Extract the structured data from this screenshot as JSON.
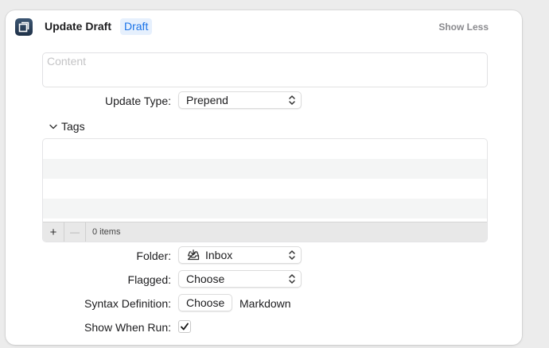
{
  "header": {
    "title": "Update Draft",
    "token": "Draft",
    "show_less": "Show Less"
  },
  "content": {
    "placeholder": "Content",
    "value": ""
  },
  "update_type": {
    "label": "Update Type:",
    "value": "Prepend"
  },
  "tags": {
    "label": "Tags",
    "count": "0 items",
    "add_symbol": "+",
    "remove_symbol": "—"
  },
  "folder": {
    "label": "Folder:",
    "value": "Inbox",
    "icon": "inbox-tray-icon"
  },
  "flagged": {
    "label": "Flagged:",
    "value": "Choose"
  },
  "syntax": {
    "label": "Syntax Definition:",
    "button": "Choose",
    "value": "Markdown"
  },
  "show_when_run": {
    "label": "Show When Run:",
    "checked": true
  },
  "colors": {
    "token_bg": "#e6f0fd",
    "token_text": "#1a73e8",
    "icon_bg": "#2b4058"
  }
}
